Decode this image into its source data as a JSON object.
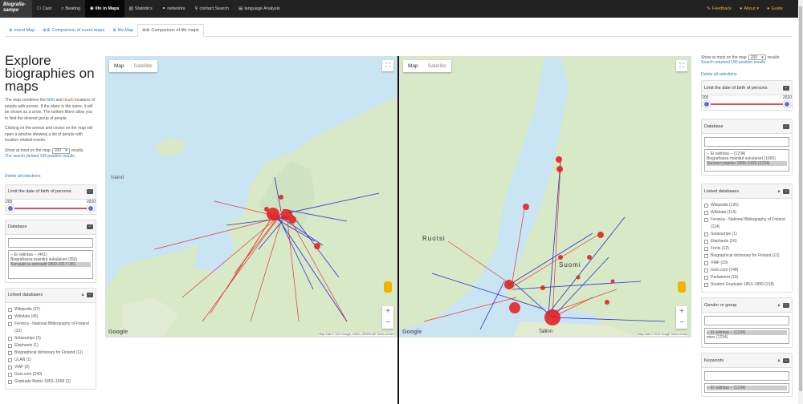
{
  "brand": {
    "line1": "Biografia-",
    "line2": "sampo"
  },
  "nav": {
    "items": [
      {
        "icon": "☐",
        "label": "Cast"
      },
      {
        "icon": "⌕",
        "label": "Beating"
      },
      {
        "icon": "⊕",
        "label": "life in Maps"
      },
      {
        "icon": "▥",
        "label": "Statistics"
      },
      {
        "icon": "⚭",
        "label": "networks"
      },
      {
        "icon": "⚲",
        "label": "contact Search"
      },
      {
        "icon": "▤",
        "label": "language Analysis"
      }
    ],
    "right": [
      {
        "icon": "✎",
        "label": "Feedback"
      },
      {
        "icon": "●",
        "label": "About ▾"
      },
      {
        "icon": "●",
        "label": "Guide"
      }
    ]
  },
  "tabs": [
    {
      "icon": "⊕",
      "label": "event Map"
    },
    {
      "icon": "⊕⊕",
      "label": "Comparison of event maps"
    },
    {
      "icon": "⊕",
      "label": "life Map"
    },
    {
      "icon": "⊕⊕",
      "label": "Comparison of life maps"
    }
  ],
  "left": {
    "title": "Explore biographies on maps",
    "d1a": "The map combines the ",
    "d1b": "birth",
    "d1c": " and ",
    "d1d": "death",
    "d1e": " locations of people with arrows. If the place is the same, it will be shown as a circle. The bottom filters allow you to limit the desired group of people.",
    "d2": "Clicking on the arrows and circles on the map will open a window showing a list of people with location related events.",
    "show_pre": "Show at most on the map",
    "show_val": "200",
    "show_post": "results.",
    "result": "The search yielded 199 position results.",
    "delete": "Delete all selections",
    "limit_title": "Limit the date of birth of persons",
    "min": "200",
    "max": "2020",
    "db_title": "Database",
    "db_items": [
      "-- Ei valintaa -- (461)",
      "Biografiassa mainitut sukulaiset (350)",
      "Kenraalit ja amiraalit 1809-1917 (45)"
    ],
    "ldb_title": "Linked databases",
    "ldb": [
      "Wikipedia (27)",
      "Wikidata (45)",
      "Fennica - National Bibliography of Finland (10)",
      "Sotasampo (3)",
      "Elephants (1)",
      "Biographical dictionary for Finland (11)",
      "ULAN (1)",
      "VIAF (9)",
      "Geni.com (240)",
      "Graduate Matrix 1853–1899 (2)"
    ]
  },
  "right": {
    "show_pre": "Show at most on the map",
    "show_val": "200",
    "show_post": "results",
    "result": "Search returned 190 position results",
    "delete": "Delete all selections",
    "limit_title": "Limit the date of birth of persons",
    "min": "200",
    "max": "2020",
    "db_title": "Database",
    "db_items": [
      "-- Ei valintaa -- (1234)",
      "Biografiassa mainitut sukulaiset (1000)",
      "Suomen papisto 1800–1920 (1234)"
    ],
    "ldb_title": "Linked databases",
    "ldb": [
      "Wikipedia (126)",
      "Wikidata (114)",
      "Fennica - National Bibliography of Finland (114)",
      "Sotasampo (1)",
      "Elephants (16)",
      "Fonts (12)",
      "Biographical dictionary for Finland (12)",
      "VIAF (33)",
      "Geni.com (748)",
      "Parliament (19)",
      "Student Graduate 1853–1899 (218)"
    ],
    "gender_title": "Gender or group",
    "gender": [
      "-- Ei valintaa -- (1234)",
      "mies (1234)"
    ],
    "kw_title": "Keywords",
    "kw": [
      "-- Ei valintaa -- (1234)"
    ]
  },
  "map": {
    "map_btn": "Map",
    "sat_btn": "Satellite",
    "google": "Google",
    "attr1": "Map Data © 2019 Google, INEGI, ORION-ME Terms of Use",
    "attr2": "Map Data © 2019 Google Terms of Use"
  },
  "maplabels": {
    "iceland": "Island",
    "sweden": "Ruotsi",
    "finland": "Suomi",
    "tallinn": "Tallinn"
  }
}
